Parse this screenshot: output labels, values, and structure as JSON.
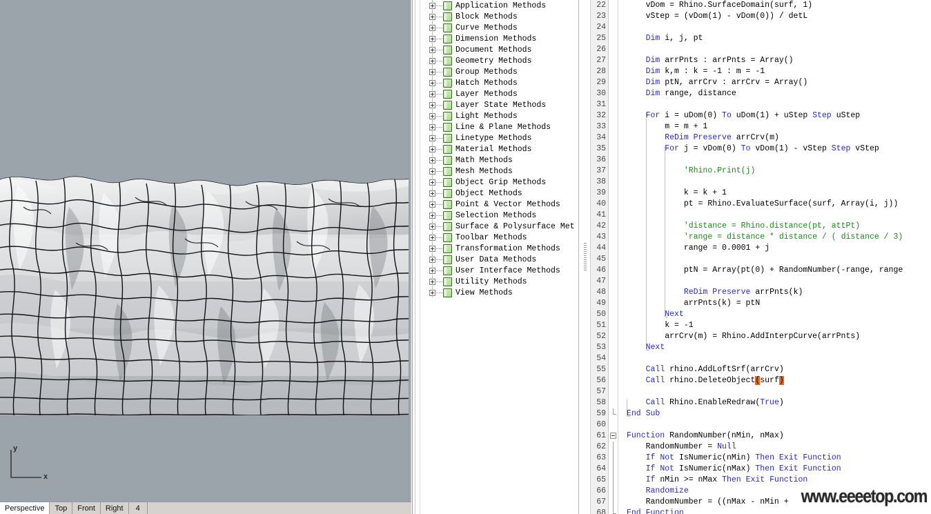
{
  "viewport": {
    "name": "rhino-perspective-viewport",
    "background_color": "#9ba3ab",
    "axis": {
      "x_label": "x",
      "y_label": "y"
    },
    "tabs": [
      {
        "label": "Perspective",
        "active": true
      },
      {
        "label": "Top",
        "active": false
      },
      {
        "label": "Front",
        "active": false
      },
      {
        "label": "Right",
        "active": false
      },
      {
        "label": "4",
        "active": false
      }
    ]
  },
  "tree": {
    "name": "rhinoscript-methods-tree",
    "items": [
      {
        "label": "Application Methods"
      },
      {
        "label": "Block Methods"
      },
      {
        "label": "Curve Methods"
      },
      {
        "label": "Dimension Methods"
      },
      {
        "label": "Document Methods"
      },
      {
        "label": "Geometry Methods"
      },
      {
        "label": "Group Methods"
      },
      {
        "label": "Hatch Methods"
      },
      {
        "label": "Layer Methods"
      },
      {
        "label": "Layer State Methods"
      },
      {
        "label": "Light Methods"
      },
      {
        "label": "Line & Plane Methods"
      },
      {
        "label": "Linetype Methods"
      },
      {
        "label": "Material Methods"
      },
      {
        "label": "Math Methods"
      },
      {
        "label": "Mesh Methods"
      },
      {
        "label": "Object Grip Methods"
      },
      {
        "label": "Object Methods"
      },
      {
        "label": "Point & Vector Methods"
      },
      {
        "label": "Selection Methods"
      },
      {
        "label": "Surface & Polysurface Met"
      },
      {
        "label": "Toolbar Methods"
      },
      {
        "label": "Transformation Methods"
      },
      {
        "label": "User Data Methods"
      },
      {
        "label": "User Interface Methods"
      },
      {
        "label": "Utility Methods"
      },
      {
        "label": "View Methods"
      }
    ]
  },
  "editor": {
    "name": "vbscript-code-editor",
    "first_line": 22,
    "last_line": 68,
    "lines": [
      {
        "n": 22,
        "html": "    <span class='b'>vDom = Rhino.SurfaceDomain(surf, 1)</span>"
      },
      {
        "n": 23,
        "html": "    vStep = (vDom(1) - vDom(0)) / detL"
      },
      {
        "n": 24,
        "html": ""
      },
      {
        "n": 25,
        "html": "    <kw>Dim</kw> i, j, pt"
      },
      {
        "n": 26,
        "html": ""
      },
      {
        "n": 27,
        "html": "    <kw>Dim</kw> arrPnts : arrPnts = Array()"
      },
      {
        "n": 28,
        "html": "    <kw>Dim</kw> k,m : k = -1 : m = -1"
      },
      {
        "n": 29,
        "html": "    <kw>Dim</kw> ptN, arrCrv : arrCrv = Array()"
      },
      {
        "n": 30,
        "html": "    <kw>Dim</kw> range, distance"
      },
      {
        "n": 31,
        "html": ""
      },
      {
        "n": 32,
        "html": "    <kw>For</kw> i = uDom(0) <kw>To</kw> uDom(1) + uStep <kw>Step</kw> uStep"
      },
      {
        "n": 33,
        "html": "        m = m + 1"
      },
      {
        "n": 34,
        "html": "        <kw>ReDim</kw> <kw>Preserve</kw> arrCrv(m)"
      },
      {
        "n": 35,
        "html": "        <kw>For</kw> j = vDom(0) <kw>To</kw> vDom(1) - vStep <kw>Step</kw> vStep"
      },
      {
        "n": 36,
        "html": ""
      },
      {
        "n": 37,
        "html": "            <cmt>'Rhino.Print(j)</cmt>"
      },
      {
        "n": 38,
        "html": ""
      },
      {
        "n": 39,
        "html": "            k = k + 1"
      },
      {
        "n": 40,
        "html": "            pt = Rhino.EvaluateSurface(surf, Array(i, j))"
      },
      {
        "n": 41,
        "html": ""
      },
      {
        "n": 42,
        "html": "            <cmt>'distance = Rhino.distance(pt, attPt)</cmt>"
      },
      {
        "n": 43,
        "html": "            <cmt>'range = distance * distance / ( distance / 3)</cmt>"
      },
      {
        "n": 44,
        "html": "            range = 0.0001 + j"
      },
      {
        "n": 45,
        "html": ""
      },
      {
        "n": 46,
        "html": "            ptN = Array(pt(0) + RandomNumber(-range, range"
      },
      {
        "n": 47,
        "html": ""
      },
      {
        "n": 48,
        "html": "            <kw>ReDim</kw> <kw>Preserve</kw> arrPnts(k)"
      },
      {
        "n": 49,
        "html": "            arrPnts(k) = ptN"
      },
      {
        "n": 50,
        "html": "        <kw>Next</kw>"
      },
      {
        "n": 51,
        "html": "        k = -1"
      },
      {
        "n": 52,
        "html": "        arrCrv(m) = Rhino.AddInterpCurve(arrPnts)"
      },
      {
        "n": 53,
        "html": "    <kw>Next</kw>"
      },
      {
        "n": 54,
        "html": ""
      },
      {
        "n": 55,
        "html": "    <kw>Call</kw> rhino.AddLoftSrf(arrCrv)"
      },
      {
        "n": 56,
        "html": "    <kw>Call</kw> rhino.DeleteObject<hl>(</hl>surf<hl>)</hl>"
      },
      {
        "n": 57,
        "html": ""
      },
      {
        "n": 58,
        "html": "    <kw>Call</kw> Rhino.EnableRedraw(<kw>True</kw>)"
      },
      {
        "n": 59,
        "html": "<kw>End Sub</kw>"
      },
      {
        "n": 60,
        "html": ""
      },
      {
        "n": 61,
        "html": "<kw>Function</kw> RandomNumber(nMin, nMax)"
      },
      {
        "n": 62,
        "html": "    RandomNumber = <kw>Null</kw>"
      },
      {
        "n": 63,
        "html": "    <kw>If</kw> <kw>Not</kw> IsNumeric(nMin) <kw>Then</kw> <kw>Exit</kw> <kw>Function</kw>"
      },
      {
        "n": 64,
        "html": "    <kw>If</kw> <kw>Not</kw> IsNumeric(nMax) <kw>Then</kw> <kw>Exit</kw> <kw>Function</kw>"
      },
      {
        "n": 65,
        "html": "    <kw>If</kw> nMin >= nMax <kw>Then</kw> <kw>Exit</kw> <kw>Function</kw>"
      },
      {
        "n": 66,
        "html": "    <kw>Randomize</kw>"
      },
      {
        "n": 67,
        "html": "    RandomNumber = ((nMax - nMin +"
      },
      {
        "n": 68,
        "html": "<kw>End Function</kw>"
      }
    ],
    "colors": {
      "keyword": "#2b2bc0",
      "comment": "#1b8a1b",
      "bracket_highlight": "#e8691a",
      "gutter_background": "#f0f0f0",
      "background": "#ffffff"
    }
  },
  "watermark": {
    "text": "www.eeeetop.com"
  }
}
